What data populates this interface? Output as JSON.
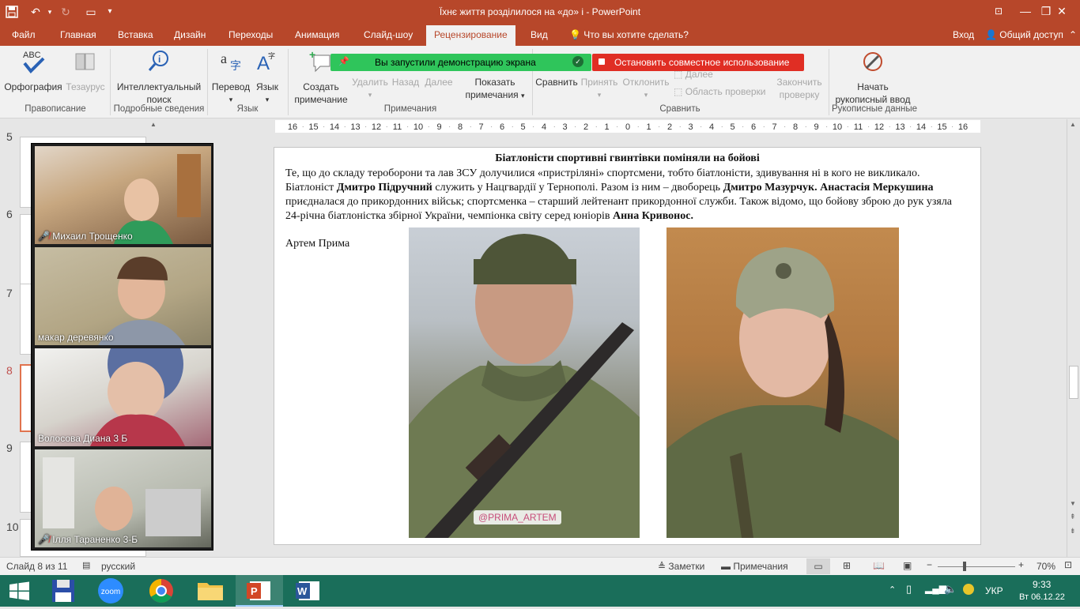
{
  "window": {
    "title": "Їхнє життя розділилося на «до» і - PowerPoint"
  },
  "tabs": [
    {
      "label": "Файл"
    },
    {
      "label": "Главная"
    },
    {
      "label": "Вставка"
    },
    {
      "label": "Дизайн"
    },
    {
      "label": "Переходы"
    },
    {
      "label": "Анимация"
    },
    {
      "label": "Слайд-шоу"
    },
    {
      "label": "Рецензирование"
    },
    {
      "label": "Вид"
    }
  ],
  "tell_me": "Что вы хотите сделать?",
  "account": {
    "signin": "Вход",
    "share": "Общий доступ"
  },
  "ribbon": {
    "spelling": "Орфография",
    "thesaurus": "Тезаурус",
    "smart_lookup_1": "Интеллектуальный",
    "smart_lookup_2": "поиск",
    "translate": "Перевод",
    "language": "Язык",
    "new_comment_1": "Создать",
    "new_comment_2": "примечание",
    "delete": "Удалить",
    "prev": "Назад",
    "next": "Далее",
    "show_comments_1": "Показать",
    "show_comments_2": "примечания",
    "compare": "Сравнить",
    "accept": "Принять",
    "reject": "Отклонить",
    "compare_next": "Далее",
    "review_pane": "Область проверки",
    "end_review_1": "Закончить",
    "end_review_2": "проверку",
    "ink_1": "Начать",
    "ink_2": "рукописный ввод",
    "groups": {
      "proofing": "Правописание",
      "insights": "Подробные сведения",
      "language": "Язык",
      "comments": "Примечания",
      "compare": "Сравнить",
      "ink": "Рукописные данные"
    }
  },
  "share_banner": {
    "started": "Вы запустили демонстрацию экрана",
    "stop": "Остановить совместное использование"
  },
  "ruler_ticks": [
    "16",
    "15",
    "14",
    "13",
    "12",
    "11",
    "10",
    "9",
    "8",
    "7",
    "6",
    "5",
    "4",
    "3",
    "2",
    "1",
    "0",
    "1",
    "2",
    "3",
    "4",
    "5",
    "6",
    "7",
    "8",
    "9",
    "10",
    "11",
    "12",
    "13",
    "14",
    "15",
    "16"
  ],
  "thumbnails": [
    {
      "num": "5"
    },
    {
      "num": "6"
    },
    {
      "num": "7"
    },
    {
      "num": "8"
    },
    {
      "num": "9"
    },
    {
      "num": "10"
    }
  ],
  "slide": {
    "heading": "Біатлоністи  спортивні гвинтівки поміняли на бойові",
    "p1a": "Те, що до складу тероборони та лав ЗСУ долучилися «пристріляні» спортсмени, тобто біатлоністи, здивування ні в кого не викликало. Біатлоніст ",
    "p1b": "Дмитро Підручний",
    "p1c": " служить у Нацгвардії у  Тернополі. Разом із ним – двоборець ",
    "p1d": "Дмитро Мазурчук.",
    "p1e": "  Анастасія Меркушина",
    "p1f": " приєдналася до прикордонних військ; спортсменка – старший лейтенант прикордонної служби. Також відомо, що бойову зброю до рук узяла 24-річна біатлоністка збірної України, чемпіонка світу серед юніорів ",
    "p1g": "Анна Кривонос.",
    "caption": "Артем Прима",
    "photo_tag": "@PRIMA_ARTEM"
  },
  "participants": [
    {
      "name": "Михаил Трощенко",
      "muted": true
    },
    {
      "name": "макар  деревянко",
      "muted": false
    },
    {
      "name": "Волосова Диана 3 Б",
      "muted": false
    },
    {
      "name": "Ілля Тараненко 3-Б",
      "muted": true
    }
  ],
  "status": {
    "slide": "Слайд 8 из 11",
    "lang": "русский",
    "notes": "Заметки",
    "comments": "Примечания",
    "zoom": "70%"
  },
  "taskbar": {
    "lang": "УКР",
    "time": "9:33",
    "date": "Вт 06.12.22",
    "zoom_label": "zoom"
  },
  "colors": {
    "accent": "#b7472a",
    "taskbar": "#1a6e5a"
  }
}
